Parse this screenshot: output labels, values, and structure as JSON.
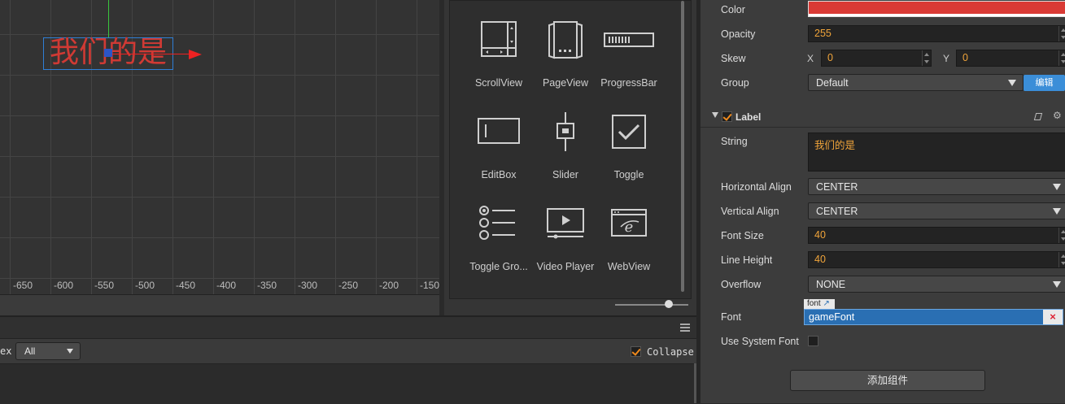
{
  "scene": {
    "label_text": "我们的是",
    "ruler_ticks": [
      "-650",
      "-600",
      "-550",
      "-500",
      "-450",
      "-400",
      "-350",
      "-300",
      "-250",
      "-200",
      "-150"
    ]
  },
  "widgets": {
    "items": [
      {
        "label": "ScrollView",
        "icon": "scrollview-icon"
      },
      {
        "label": "PageView",
        "icon": "pageview-icon"
      },
      {
        "label": "ProgressBar",
        "icon": "progressbar-icon"
      },
      {
        "label": "EditBox",
        "icon": "editbox-icon"
      },
      {
        "label": "Slider",
        "icon": "slider-icon"
      },
      {
        "label": "Toggle",
        "icon": "toggle-icon"
      },
      {
        "label": "Toggle Gro...",
        "icon": "toggle-group-icon"
      },
      {
        "label": "Video Player",
        "icon": "video-player-icon"
      },
      {
        "label": "WebView",
        "icon": "webview-icon"
      }
    ]
  },
  "console": {
    "filter_label": "ex",
    "filter_value": "All",
    "collapse_label": "Collapse",
    "collapse_checked": true
  },
  "inspector": {
    "color_label": "Color",
    "color_value": "#d93a35",
    "opacity_label": "Opacity",
    "opacity_value": "255",
    "skew_label": "Skew",
    "skew_x_label": "X",
    "skew_x_value": "0",
    "skew_y_label": "Y",
    "skew_y_value": "0",
    "group_label": "Group",
    "group_value": "Default",
    "group_edit_button": "编辑",
    "label_component": "Label",
    "label_enabled": true,
    "string_label": "String",
    "string_value": "我们的是",
    "h_align_label": "Horizontal Align",
    "h_align_value": "CENTER",
    "v_align_label": "Vertical Align",
    "v_align_value": "CENTER",
    "font_size_label": "Font Size",
    "font_size_value": "40",
    "line_height_label": "Line Height",
    "line_height_value": "40",
    "overflow_label": "Overflow",
    "overflow_value": "NONE",
    "font_label": "Font",
    "font_tag": "font",
    "font_value": "gameFont",
    "font_clear": "×",
    "use_system_font_label": "Use System Font",
    "use_system_font_checked": false,
    "add_component_button": "添加组件"
  }
}
